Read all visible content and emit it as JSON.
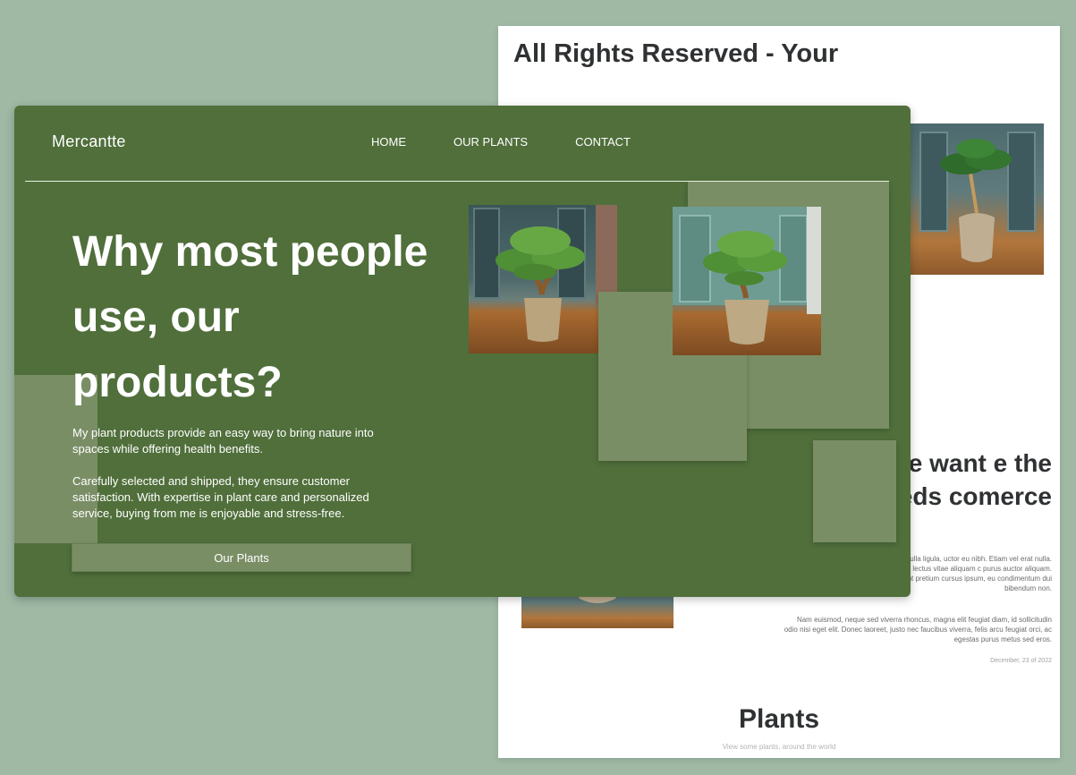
{
  "background_page": {
    "heading": "All Rights Reserved - Your",
    "section_title": "hy we want e the seeds comerce",
    "paragraph_1": "consectetur adipiscing elit. Morbi nulla ligula, uctor eu nibh. Etiam vel erat nulla. Cras eget s. Phasellus scelerisque lectus vitae aliquam c purus auctor aliquam. Praesent non luctus purus. Praesent pretium cursus ipsum, eu condimentum dui bibendum non.",
    "paragraph_2": "Nam euismod, neque sed viverra rhoncus, magna elit feugiat diam, id sollicitudin odio nisi eget elit. Donec laoreet, justo nec faucibus viverra, felis arcu feugiat orci, ac egestas purus metus sed eros.",
    "date": "December, 23 of 2022",
    "plants_title": "Plants",
    "plants_subtitle": "View some plants, around the world"
  },
  "header": {
    "logo": "Mercantte",
    "nav": [
      {
        "label": "HOME"
      },
      {
        "label": "OUR PLANTS"
      },
      {
        "label": "CONTACT"
      }
    ]
  },
  "hero": {
    "title": "Why most people use, our products?",
    "paragraph_1": "My plant products provide an easy way to bring nature into spaces while offering health benefits.",
    "paragraph_2": "Carefully selected and shipped, they ensure customer satisfaction. With expertise in plant care and personalized service, buying from me is enjoyable and stress-free.",
    "cta_label": "Our Plants"
  },
  "colors": {
    "page_background": "#9fb9a5",
    "card_green": "#506f3b",
    "panel_green": "#7a8e66",
    "text_dark": "#2f3133"
  }
}
